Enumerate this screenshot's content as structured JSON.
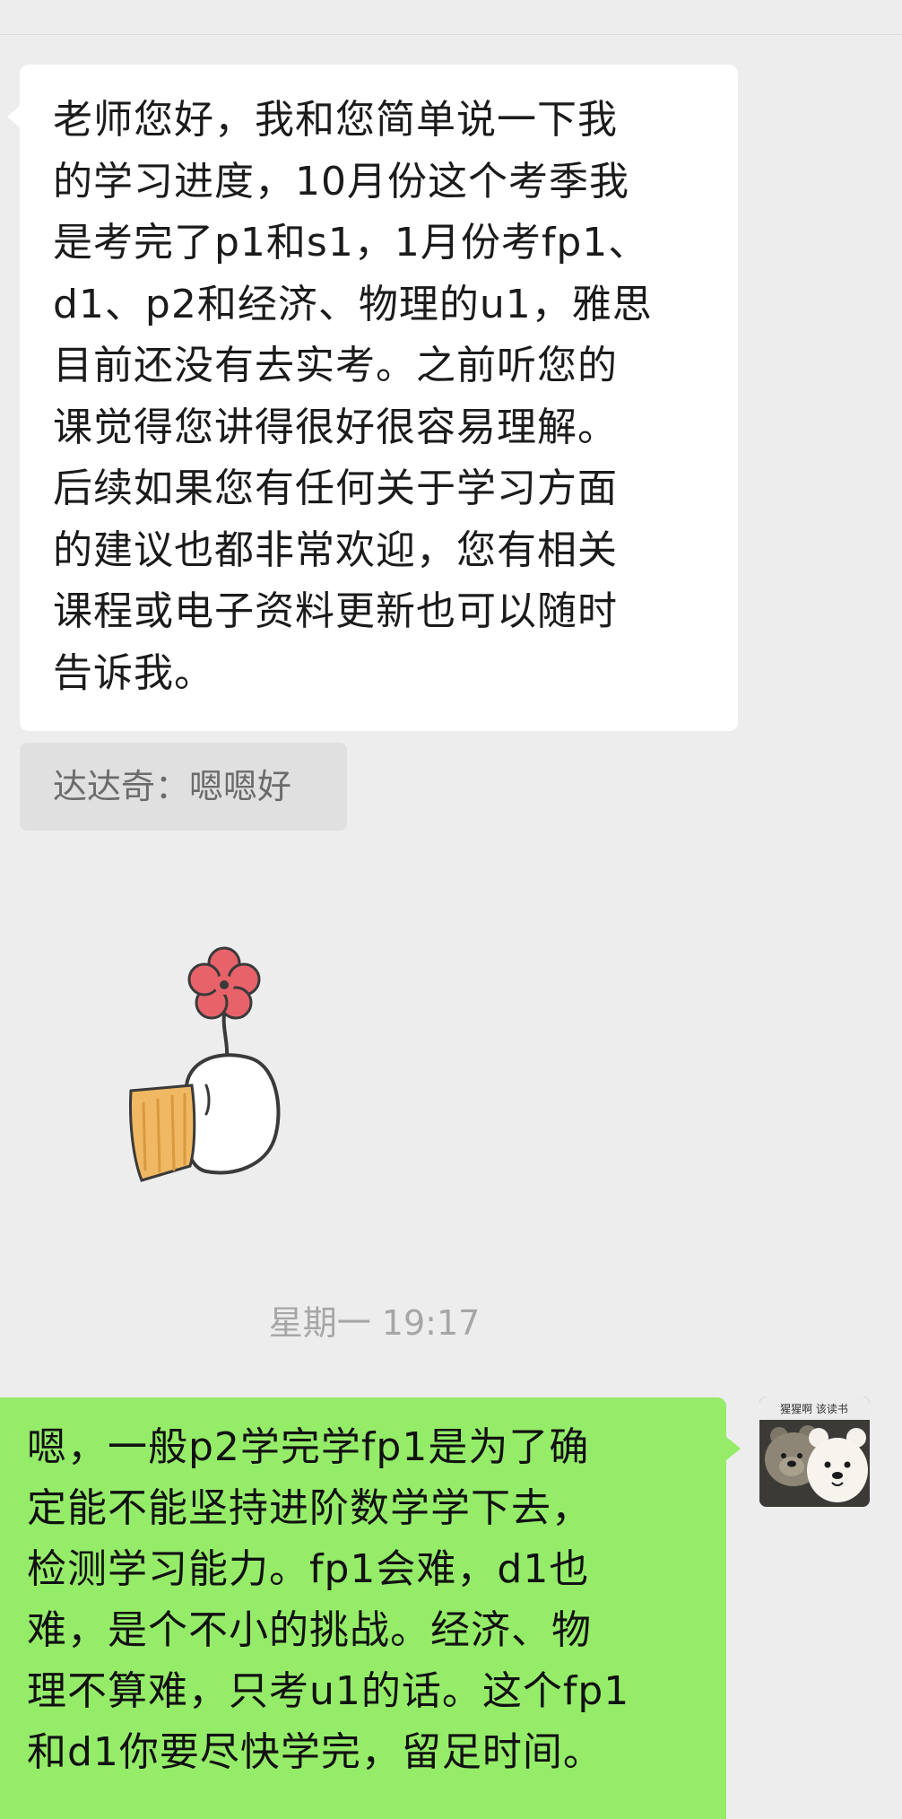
{
  "chat": {
    "incoming_message": {
      "lines": [
        "老师您好，我和您简单说一下我",
        "的学习进度，10月份这个考季我",
        "是考完了p1和s1，1月份考fp1、",
        "d1、p2和经济、物理的u1，雅思",
        "目前还没有去实考。之前听您的",
        "课觉得您讲得很好很容易理解。",
        "后续如果您有任何关于学习方面",
        "的建议也都非常欢迎，您有相关",
        "课程或电子资料更新也可以随时",
        "告诉我。"
      ]
    },
    "quote": {
      "text": "达达奇：嗯嗯好"
    },
    "sticker": {
      "icon": "flower-paw-sticker-icon",
      "colors": {
        "flower": "#e8626a",
        "paw": "#ffffff",
        "cuff": "#f0b862",
        "outline": "#3a3a3a"
      }
    },
    "timestamp": "星期一 19:17",
    "outgoing_message": {
      "lines": [
        "嗯，一般p2学完学fp1是为了确",
        "定能不能坚持进阶数学学下去，",
        "检测学习能力。fp1会难，d1也",
        "难，是个不小的挑战。经济、物",
        "理不算难，只考u1的话。这个fp1",
        "和d1你要尽快学完，留足时间。"
      ]
    },
    "avatar": {
      "text": "猩猩啊 该读书",
      "icon": "bear-avatar-icon"
    }
  },
  "colors": {
    "background": "#ededed",
    "incoming_bubble": "#ffffff",
    "outgoing_bubble": "#95ec69",
    "quote_bubble": "#e0e0e0",
    "timestamp_text": "#a6a6a6"
  }
}
